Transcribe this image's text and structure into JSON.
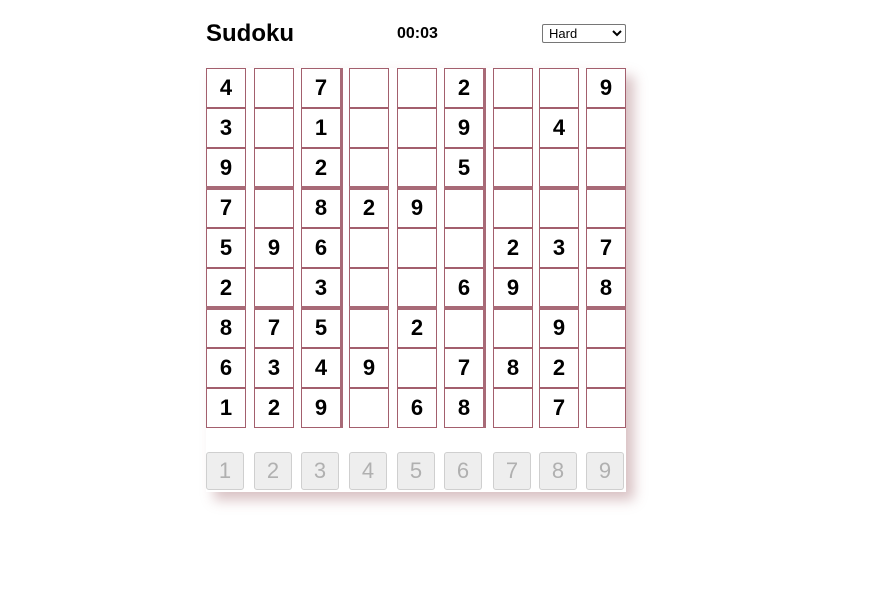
{
  "header": {
    "title": "Sudoku",
    "timer": "00:03",
    "difficulty": {
      "selected": "Hard",
      "options": [
        "Hard"
      ]
    }
  },
  "board": {
    "rows": [
      [
        "4",
        "",
        "7",
        "",
        "",
        "2",
        "",
        "",
        "9"
      ],
      [
        "3",
        "",
        "1",
        "",
        "",
        "9",
        "",
        "4",
        ""
      ],
      [
        "9",
        "",
        "2",
        "",
        "",
        "5",
        "",
        "",
        ""
      ],
      [
        "7",
        "",
        "8",
        "2",
        "9",
        "",
        "",
        "",
        ""
      ],
      [
        "5",
        "9",
        "6",
        "",
        "",
        "",
        "2",
        "3",
        "7"
      ],
      [
        "2",
        "",
        "3",
        "",
        "",
        "6",
        "9",
        "",
        "8"
      ],
      [
        "8",
        "7",
        "5",
        "",
        "2",
        "",
        "",
        "9",
        ""
      ],
      [
        "6",
        "3",
        "4",
        "9",
        "",
        "7",
        "8",
        "2",
        ""
      ],
      [
        "1",
        "2",
        "9",
        "",
        "6",
        "8",
        "",
        "7",
        ""
      ]
    ]
  },
  "numpad": {
    "buttons": [
      "1",
      "2",
      "3",
      "4",
      "5",
      "6",
      "7",
      "8",
      "9"
    ]
  },
  "colors": {
    "cell_border": "#a35f6d",
    "box_border": "#a86a77",
    "numpad_bg": "#eeeeee",
    "numpad_text": "#b0b0b0"
  }
}
